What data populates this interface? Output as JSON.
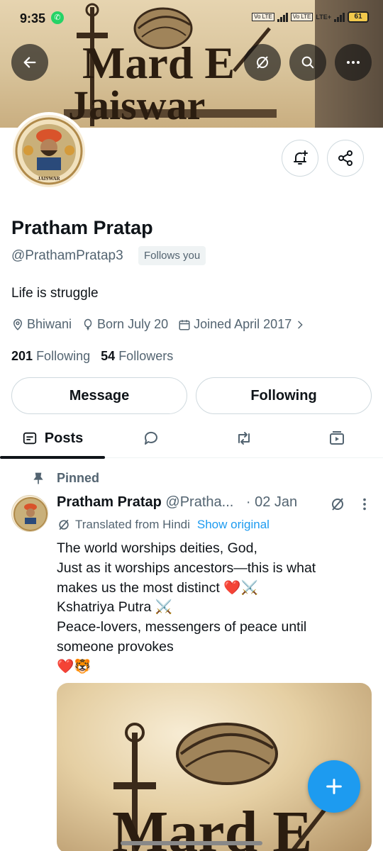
{
  "status": {
    "time": "9:35",
    "battery": "61",
    "volte1": "Vo LTE",
    "volte2": "Vo LTE",
    "network": "LTE+"
  },
  "banner": {
    "line1": "Mard E",
    "line2": "Jaiswar"
  },
  "avatar_text": "JAISWAR",
  "profile": {
    "name": "Pratham Pratap",
    "handle": "@PrathamPratap3",
    "follows_badge": "Follows you",
    "bio": "Life is struggle",
    "location": "Bhiwani",
    "born": "Born July 20",
    "joined": "Joined April 2017",
    "following_count": "201",
    "following_label": "Following",
    "followers_count": "54",
    "followers_label": "Followers"
  },
  "actions": {
    "message": "Message",
    "following": "Following"
  },
  "tabs": {
    "posts": "Posts"
  },
  "post": {
    "pinned_label": "Pinned",
    "author_name": "Pratham Pratap",
    "author_handle": "@Pratha...",
    "date": "· 02 Jan",
    "translated": "Translated from Hindi",
    "show_original": "Show original",
    "lines": [
      "The world worships deities, God,",
      "Just as it worships ancestors—this is what",
      "makes us the most distinct ❤️⚔️",
      "Kshatriya Putra ⚔️",
      "Peace-lovers, messengers of peace until",
      "someone provokes",
      "❤️🐯"
    ],
    "image_text": "Mard E"
  },
  "colors": {
    "accent": "#1d9bf0",
    "secondary_text": "#536471",
    "border": "#cfd9de"
  }
}
